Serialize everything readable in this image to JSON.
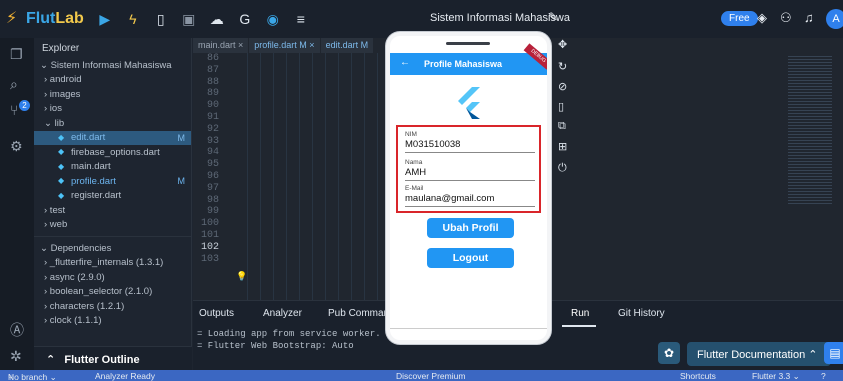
{
  "topbar": {
    "brand_flut": "Flut",
    "brand_lab": "Lab",
    "project_title": "Sistem Informasi Mahasiswa",
    "free_label": "Free",
    "avatar_letter": "A"
  },
  "tabs": [
    {
      "label": "main.dart ×"
    },
    {
      "label": "profile.dart M ×"
    },
    {
      "label": "edit.dart M"
    }
  ],
  "explorer": {
    "title": "Explorer",
    "items": [
      {
        "label": "⌄ Sistem Informasi Mahasiswa"
      },
      {
        "label": "› android"
      },
      {
        "label": "› images"
      },
      {
        "label": "› ios"
      },
      {
        "label": "⌄ lib"
      },
      {
        "label": "edit.dart",
        "mod": "M"
      },
      {
        "label": "firebase_options.dart"
      },
      {
        "label": "main.dart"
      },
      {
        "label": "profile.dart",
        "mod": "M"
      },
      {
        "label": "register.dart"
      },
      {
        "label": "› test"
      },
      {
        "label": "› web"
      }
    ],
    "deps_header": "⌄ Dependencies",
    "deps": [
      {
        "label": "› _flutterfire_internals (1.3.1)"
      },
      {
        "label": "› async (2.9.0)"
      },
      {
        "label": "› boolean_selector (2.1.0)"
      },
      {
        "label": "› characters (1.2.1)"
      },
      {
        "label": "› clock (1.1.1)"
      }
    ],
    "outline_label": "Flutter Outline"
  },
  "editor": {
    "line_numbers": [
      "86",
      "87",
      "88",
      "89",
      "90",
      "91",
      "92",
      "93",
      "94",
      "95",
      "96",
      "97",
      "98",
      "99",
      "100",
      "101",
      "102",
      "103"
    ],
    "current_line": "102"
  },
  "panel": {
    "tabs": [
      "Outputs",
      "Analyzer",
      "Pub Command",
      "Run",
      "Git History"
    ],
    "log_lines": [
      "= Loading app from service worker.",
      "= Flutter Web Bootstrap: Auto"
    ],
    "flutter_doc_label": "Flutter Documentation"
  },
  "status": {
    "branch": "No branch ⌄",
    "analyzer": "Analyzer Ready",
    "discover": "Discover Premium",
    "shortcuts": "Shortcuts",
    "flutter_version": "Flutter 3.3 ⌄"
  },
  "phone": {
    "appbar_title": "Profile Mahasiswa",
    "debug_label": "DEBUG",
    "nim_label": "NIM",
    "nim_value": "M031510038",
    "nama_label": "Nama",
    "nama_value": "AMH",
    "email_label": "E-Mail",
    "email_value": "maulana@gmail.com",
    "btn_ubah": "Ubah Profil",
    "btn_logout": "Logout"
  },
  "colors": {
    "accent": "#2196f3",
    "status_bar": "#3b67c2",
    "highlight_border": "#d9252a"
  }
}
